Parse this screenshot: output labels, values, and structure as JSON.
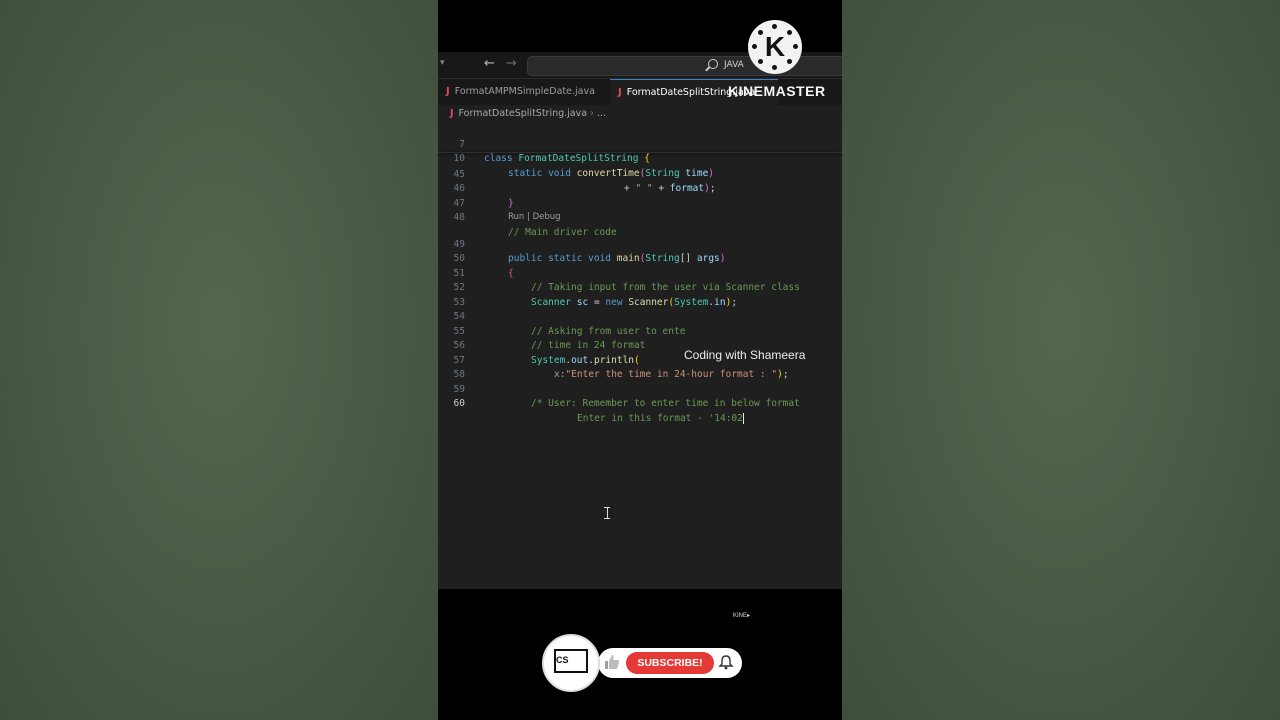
{
  "search": {
    "text": "JAVA"
  },
  "tabs": [
    {
      "label": "FormatAMPMSimpleDate.java",
      "active": false
    },
    {
      "label": "FormatDateSplitString.java",
      "active": true
    }
  ],
  "breadcrumb": {
    "file": "FormatDateSplitString.java",
    "more": "..."
  },
  "code": {
    "sticky": [
      {
        "num": "7",
        "text": "class FormatDateSplitString {"
      },
      {
        "num": "10",
        "text": "static void convertTime(String time)"
      }
    ],
    "lines": [
      {
        "num": "45",
        "text": "+ \" \" + format);"
      },
      {
        "num": "46",
        "text": "}"
      },
      {
        "num": "47",
        "text": ""
      },
      {
        "num": "48",
        "text": "// Main driver code"
      },
      {
        "num": "49",
        "text": "public static void main(String[] args)"
      },
      {
        "num": "50",
        "text": "{"
      },
      {
        "num": "51",
        "text": "// Taking input from the user via Scanner class"
      },
      {
        "num": "52",
        "text": "Scanner sc = new Scanner(System.in);"
      },
      {
        "num": "53",
        "text": ""
      },
      {
        "num": "54",
        "text": "// Asking from user to ente"
      },
      {
        "num": "55",
        "text": "// time in 24 format"
      },
      {
        "num": "56",
        "text": "System.out.println("
      },
      {
        "num": "57",
        "text": "x:\"Enter the time in 24-hour format : \");"
      },
      {
        "num": "58",
        "text": ""
      },
      {
        "num": "59",
        "text": "/* User: Remember to enter time in below format"
      },
      {
        "num": "60",
        "text": "Enter in this format - '14:02"
      }
    ],
    "codelens": "Run | Debug"
  },
  "overlay": {
    "watermark": "Coding with Shameera",
    "kinemaster_logo_letter": "K",
    "kinemaster_brand": "KINEMASTER",
    "kinemaster_small": "KINE▸",
    "channel_logo_text": "CS",
    "subscribe_label": "SUBSCRIBE!"
  },
  "colors": {
    "background": "#4a5a47",
    "editor_bg": "#1f1f1f",
    "subscribe_red": "#e53935",
    "java_icon": "#e04a5a"
  }
}
